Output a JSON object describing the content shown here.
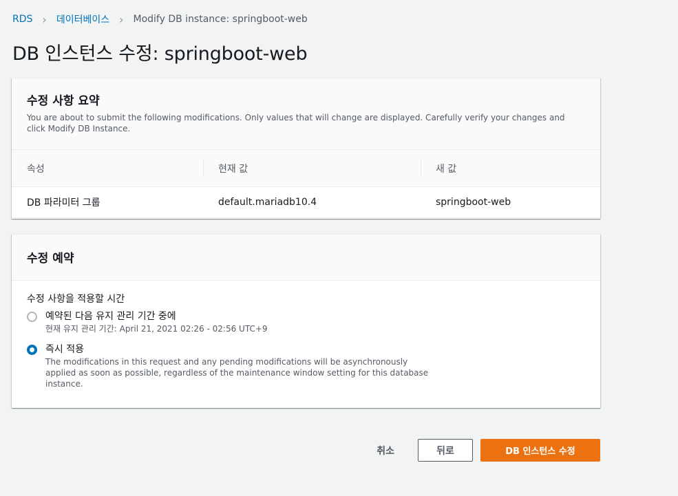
{
  "breadcrumb": {
    "items": [
      "RDS",
      "데이터베이스"
    ],
    "separator": "›",
    "current": "Modify DB instance: springboot-web"
  },
  "page": {
    "title": "DB 인스턴스 수정: springboot-web"
  },
  "summary": {
    "title": "수정 사항 요약",
    "description": "You are about to submit the following modifications. Only values that will change are displayed. Carefully verify your changes and click Modify DB Instance.",
    "columns": [
      "속성",
      "현재 값",
      "새 값"
    ],
    "rows": [
      [
        "DB 파라미터 그룹",
        "default.mariadb10.4",
        "springboot-web"
      ]
    ]
  },
  "schedule": {
    "title": "수정 예약",
    "field_label": "수정 사항을 적용할 시간",
    "options": [
      {
        "label": "예약된 다음 유지 관리 기간 중에",
        "description": "현재 유지 관리 기간: April 21, 2021 02:26 - 02:56 UTC+9",
        "checked": false
      },
      {
        "label": "즉시 적용",
        "description": "The modifications in this request and any pending modifications will be asynchronously applied as soon as possible, regardless of the maintenance window setting for this database instance.",
        "checked": true
      }
    ]
  },
  "actions": {
    "cancel": "취소",
    "back": "뒤로",
    "submit": "DB 인스턴스 수정"
  },
  "colors": {
    "link": "#0073bb",
    "primary": "#ec7211",
    "radio_selected": "#0073bb",
    "background": "#f2f3f3"
  }
}
